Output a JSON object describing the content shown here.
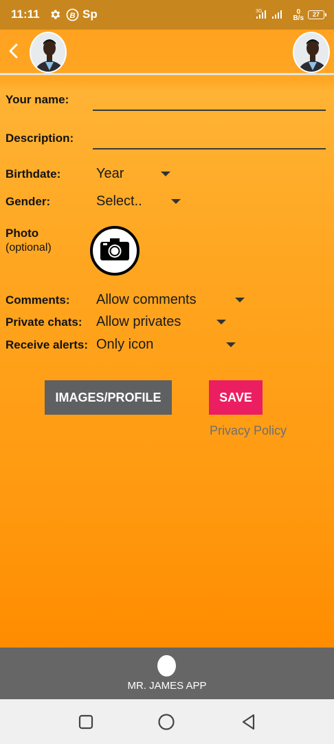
{
  "status_bar": {
    "time": "11:11",
    "carrier": "Sp",
    "network": "3G",
    "speed_value": "0",
    "speed_unit": "B/s",
    "battery": "27"
  },
  "form": {
    "name_label": "Your name:",
    "name_value": "",
    "description_label": "Description:",
    "description_value": "",
    "birthdate_label": "Birthdate:",
    "birthdate_value": "Year",
    "gender_label": "Gender:",
    "gender_value": "Select..",
    "photo_label": "Photo",
    "photo_sublabel": "(optional)",
    "comments_label": "Comments:",
    "comments_value": "Allow comments",
    "private_chats_label": "Private chats:",
    "private_chats_value": "Allow privates",
    "receive_alerts_label": "Receive alerts:",
    "receive_alerts_value": "Only icon"
  },
  "actions": {
    "images_profile": "IMAGES/PROFILE",
    "save": "SAVE",
    "privacy_policy": "Privacy Policy"
  },
  "footer": {
    "app_name": "MR. JAMES APP"
  },
  "colors": {
    "accent": "#ff9a10",
    "save": "#ec1e62",
    "images_button": "#5f6061"
  },
  "icons": [
    "settings-icon",
    "bitcoin-icon",
    "signal-icon",
    "battery-icon",
    "back-arrow-icon",
    "camera-icon",
    "nav-recents-icon",
    "nav-home-icon",
    "nav-back-icon"
  ]
}
